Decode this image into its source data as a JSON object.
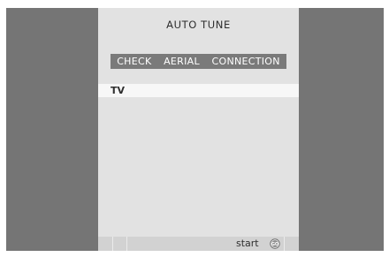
{
  "screen": {
    "title": "AUTO TUNE",
    "banner": "CHECK  AERIAL  CONNECTION",
    "item_label": "TV"
  },
  "footer": {
    "start_label": "start",
    "go_icon": "go-button-icon",
    "go_icon_text": "GO"
  },
  "colors": {
    "side_panels": "#757575",
    "screen_background": "#e2e2e2",
    "banner_background": "#7a7a7a",
    "footer_background": "#d2d2d2"
  }
}
